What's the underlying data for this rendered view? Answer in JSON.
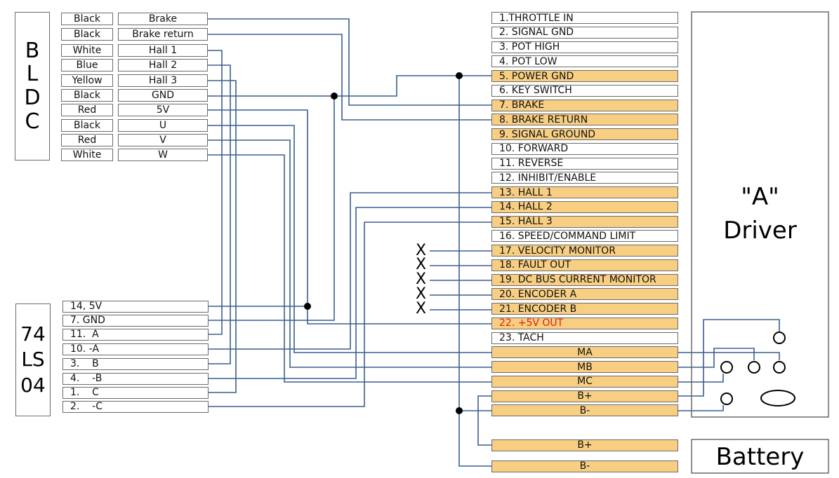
{
  "bldc": {
    "title_letters": [
      "B",
      "L",
      "D",
      "C"
    ],
    "rows": [
      {
        "color": "Black",
        "signal": "Brake"
      },
      {
        "color": "Black",
        "signal": "Brake return"
      },
      {
        "color": "White",
        "signal": "Hall 1"
      },
      {
        "color": "Blue",
        "signal": "Hall 2"
      },
      {
        "color": "Yellow",
        "signal": "Hall 3"
      },
      {
        "color": "Black",
        "signal": "GND"
      },
      {
        "color": "Red",
        "signal": "5V"
      },
      {
        "color": "Black",
        "signal": "U"
      },
      {
        "color": "Red",
        "signal": "V"
      },
      {
        "color": "White",
        "signal": "W"
      }
    ]
  },
  "ic": {
    "title_lines": [
      "74",
      "LS",
      "04"
    ],
    "pins": [
      "14, 5V",
      "7. GND",
      "11.  A",
      "10. -A",
      "3.    B",
      "4.    -B",
      "1.    C",
      "2.    -C"
    ]
  },
  "driver": {
    "title_line1": "\"A\"",
    "title_line2": "Driver",
    "pins": [
      {
        "label": "1.THROTTLE IN",
        "highlight": false
      },
      {
        "label": "2. SIGNAL GND",
        "highlight": false
      },
      {
        "label": "3. POT HIGH",
        "highlight": false
      },
      {
        "label": "4. POT LOW",
        "highlight": false
      },
      {
        "label": "5. POWER GND",
        "highlight": true
      },
      {
        "label": "6. KEY SWITCH",
        "highlight": false
      },
      {
        "label": "7. BRAKE",
        "highlight": true
      },
      {
        "label": "8. BRAKE RETURN",
        "highlight": true
      },
      {
        "label": "9. SIGNAL GROUND",
        "highlight": true
      },
      {
        "label": "10. FORWARD",
        "highlight": false
      },
      {
        "label": "11. REVERSE",
        "highlight": false
      },
      {
        "label": "12. INHIBIT/ENABLE",
        "highlight": false
      },
      {
        "label": "13. HALL 1",
        "highlight": true
      },
      {
        "label": "14. HALL 2",
        "highlight": true
      },
      {
        "label": "15. HALL 3",
        "highlight": true
      },
      {
        "label": "16. SPEED/COMMAND LIMIT",
        "highlight": false
      },
      {
        "label": "17. VELOCITY MONITOR",
        "highlight": true,
        "unconnected": true
      },
      {
        "label": "18. FAULT OUT",
        "highlight": true,
        "unconnected": true
      },
      {
        "label": "19. DC BUS CURRENT MONITOR",
        "highlight": true,
        "unconnected": true
      },
      {
        "label": "20. ENCODER A",
        "highlight": true,
        "unconnected": true
      },
      {
        "label": "21. ENCODER B",
        "highlight": true,
        "unconnected": true
      },
      {
        "label": "22. +5V OUT",
        "highlight": true,
        "text_color": "#e0200c"
      },
      {
        "label": "23. TACH",
        "highlight": false
      }
    ],
    "power_terminals": [
      "MA",
      "MB",
      "MC",
      "B+",
      "B-"
    ],
    "unconnected_mark": "X"
  },
  "battery": {
    "title": "Battery",
    "terminals": [
      "B+",
      "B-"
    ]
  },
  "colors": {
    "wire": "#3a5f8f",
    "highlight_fill": "#f8cf82",
    "box_border": "#6b6b6b",
    "red_text": "#e0200c"
  }
}
